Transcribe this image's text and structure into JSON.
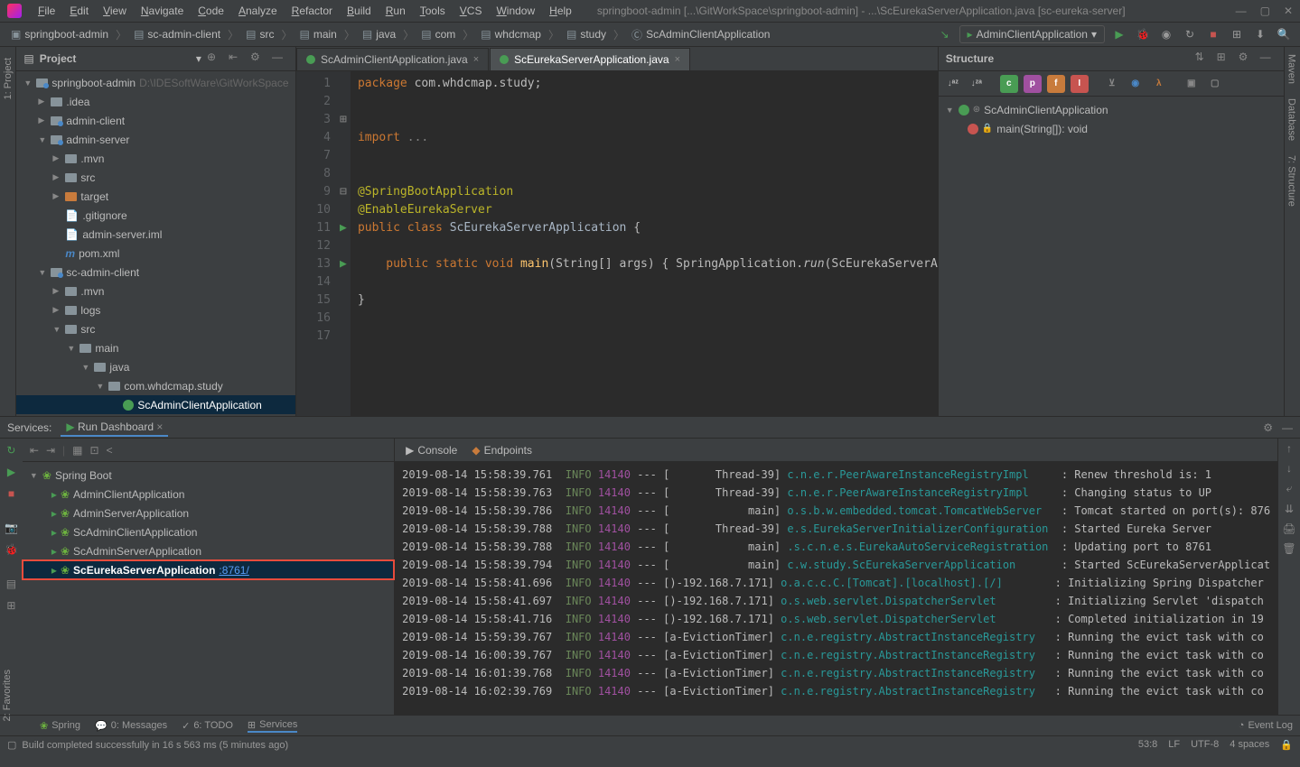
{
  "window": {
    "title": "springboot-admin [...\\GitWorkSpace\\springboot-admin] - ...\\ScEurekaServerApplication.java [sc-eureka-server]"
  },
  "menu": [
    "File",
    "Edit",
    "View",
    "Navigate",
    "Code",
    "Analyze",
    "Refactor",
    "Build",
    "Run",
    "Tools",
    "VCS",
    "Window",
    "Help"
  ],
  "breadcrumb": [
    "springboot-admin",
    "sc-admin-client",
    "src",
    "main",
    "java",
    "com",
    "whdcmap",
    "study",
    "ScAdminClientApplication"
  ],
  "runConfig": "AdminClientApplication",
  "projectPanel": {
    "title": "Project",
    "rootName": "springboot-admin",
    "rootPath": "D:\\IDESoftWare\\GitWorkSpace"
  },
  "tree": [
    {
      "d": 0,
      "exp": "▼",
      "icon": "folder-blue",
      "label": "springboot-admin",
      "hint": "D:\\IDESoftWare\\GitWorkSpace"
    },
    {
      "d": 1,
      "exp": "▶",
      "icon": "folder",
      "label": ".idea"
    },
    {
      "d": 1,
      "exp": "▶",
      "icon": "folder-blue",
      "label": "admin-client"
    },
    {
      "d": 1,
      "exp": "▼",
      "icon": "folder-blue",
      "label": "admin-server"
    },
    {
      "d": 2,
      "exp": "▶",
      "icon": "folder",
      "label": ".mvn"
    },
    {
      "d": 2,
      "exp": "▶",
      "icon": "folder",
      "label": "src"
    },
    {
      "d": 2,
      "exp": "▶",
      "icon": "folder-orange",
      "label": "target"
    },
    {
      "d": 2,
      "exp": "",
      "icon": "file",
      "label": ".gitignore"
    },
    {
      "d": 2,
      "exp": "",
      "icon": "file",
      "label": "admin-server.iml"
    },
    {
      "d": 2,
      "exp": "",
      "icon": "file-m",
      "label": "pom.xml"
    },
    {
      "d": 1,
      "exp": "▼",
      "icon": "folder-blue",
      "label": "sc-admin-client"
    },
    {
      "d": 2,
      "exp": "▶",
      "icon": "folder",
      "label": ".mvn"
    },
    {
      "d": 2,
      "exp": "▶",
      "icon": "folder",
      "label": "logs"
    },
    {
      "d": 2,
      "exp": "▼",
      "icon": "folder",
      "label": "src"
    },
    {
      "d": 3,
      "exp": "▼",
      "icon": "folder",
      "label": "main"
    },
    {
      "d": 4,
      "exp": "▼",
      "icon": "folder",
      "label": "java"
    },
    {
      "d": 5,
      "exp": "▼",
      "icon": "folder",
      "label": "com.whdcmap.study"
    },
    {
      "d": 6,
      "exp": "",
      "icon": "class",
      "label": "ScAdminClientApplication",
      "selected": true
    }
  ],
  "editorTabs": [
    {
      "label": "ScAdminClientApplication.java",
      "active": false
    },
    {
      "label": "ScEurekaServerApplication.java",
      "active": true
    }
  ],
  "code": {
    "lines": [
      "1",
      "2",
      "3",
      "4",
      "",
      "7",
      "8",
      "9",
      "10",
      "11",
      "12",
      "13",
      "14",
      "15",
      "16",
      "17"
    ],
    "l1a": "package ",
    "l1b": "com.whdcmap.study;",
    "l3a": "import ",
    "l3b": "...",
    "l7": "@SpringBootApplication",
    "l8": "@EnableEurekaServer",
    "l9a": "public class ",
    "l9b": "ScEurekaServerApplication ",
    "l9c": "{",
    "l11a": "    public static void ",
    "l11b": "main",
    "l11c": "(String[] args) ",
    "l11d": "{ ",
    "l11e": "SpringApplication.",
    "l11f": "run",
    "l11g": "(ScEurekaServerA",
    "l13": "}"
  },
  "structure": {
    "title": "Structure",
    "root": "ScAdminClientApplication",
    "method": "main(String[]): void"
  },
  "services": {
    "title": "Services:",
    "tab": "Run Dashboard",
    "root": "Spring Boot",
    "apps": [
      {
        "label": "AdminClientApplication"
      },
      {
        "label": "AdminServerApplication"
      },
      {
        "label": "ScAdminClientApplication"
      },
      {
        "label": "ScAdminServerApplication"
      },
      {
        "label": "ScEurekaServerApplication",
        "port": ":8761/",
        "highlighted": true
      }
    ]
  },
  "consoleTabs": [
    "Console",
    "Endpoints"
  ],
  "console": [
    {
      "ts": "2019-08-14 15:58:39.761",
      "lvl": "INFO",
      "pid": "14140",
      "th": "--- [       Thread-39]",
      "cls": "c.n.e.r.PeerAwareInstanceRegistryImpl",
      "msg": ": Renew threshold is: 1"
    },
    {
      "ts": "2019-08-14 15:58:39.763",
      "lvl": "INFO",
      "pid": "14140",
      "th": "--- [       Thread-39]",
      "cls": "c.n.e.r.PeerAwareInstanceRegistryImpl",
      "msg": ": Changing status to UP"
    },
    {
      "ts": "2019-08-14 15:58:39.786",
      "lvl": "INFO",
      "pid": "14140",
      "th": "--- [            main]",
      "cls": "o.s.b.w.embedded.tomcat.TomcatWebServer",
      "msg": ": Tomcat started on port(s): 876"
    },
    {
      "ts": "2019-08-14 15:58:39.788",
      "lvl": "INFO",
      "pid": "14140",
      "th": "--- [       Thread-39]",
      "cls": "e.s.EurekaServerInitializerConfiguration",
      "msg": ": Started Eureka Server"
    },
    {
      "ts": "2019-08-14 15:58:39.788",
      "lvl": "INFO",
      "pid": "14140",
      "th": "--- [            main]",
      "cls": ".s.c.n.e.s.EurekaAutoServiceRegistration",
      "msg": ": Updating port to 8761"
    },
    {
      "ts": "2019-08-14 15:58:39.794",
      "lvl": "INFO",
      "pid": "14140",
      "th": "--- [            main]",
      "cls": "c.w.study.ScEurekaServerApplication",
      "msg": ": Started ScEurekaServerApplicat"
    },
    {
      "ts": "2019-08-14 15:58:41.696",
      "lvl": "INFO",
      "pid": "14140",
      "th": "--- [)-192.168.7.171]",
      "cls": "o.a.c.c.C.[Tomcat].[localhost].[/]",
      "msg": ": Initializing Spring Dispatcher"
    },
    {
      "ts": "2019-08-14 15:58:41.697",
      "lvl": "INFO",
      "pid": "14140",
      "th": "--- [)-192.168.7.171]",
      "cls": "o.s.web.servlet.DispatcherServlet",
      "msg": ": Initializing Servlet 'dispatch"
    },
    {
      "ts": "2019-08-14 15:58:41.716",
      "lvl": "INFO",
      "pid": "14140",
      "th": "--- [)-192.168.7.171]",
      "cls": "o.s.web.servlet.DispatcherServlet",
      "msg": ": Completed initialization in 19"
    },
    {
      "ts": "2019-08-14 15:59:39.767",
      "lvl": "INFO",
      "pid": "14140",
      "th": "--- [a-EvictionTimer]",
      "cls": "c.n.e.registry.AbstractInstanceRegistry",
      "msg": ": Running the evict task with co"
    },
    {
      "ts": "2019-08-14 16:00:39.767",
      "lvl": "INFO",
      "pid": "14140",
      "th": "--- [a-EvictionTimer]",
      "cls": "c.n.e.registry.AbstractInstanceRegistry",
      "msg": ": Running the evict task with co"
    },
    {
      "ts": "2019-08-14 16:01:39.768",
      "lvl": "INFO",
      "pid": "14140",
      "th": "--- [a-EvictionTimer]",
      "cls": "c.n.e.registry.AbstractInstanceRegistry",
      "msg": ": Running the evict task with co"
    },
    {
      "ts": "2019-08-14 16:02:39.769",
      "lvl": "INFO",
      "pid": "14140",
      "th": "--- [a-EvictionTimer]",
      "cls": "c.n.e.registry.AbstractInstanceRegistry",
      "msg": ": Running the evict task with co"
    }
  ],
  "bottomBar": [
    "Spring",
    "0: Messages",
    "6: TODO",
    "Services"
  ],
  "status": {
    "msg": "Build completed successfully in 16 s 563 ms (5 minutes ago)",
    "eventLog": "Event Log",
    "pos": "53:8",
    "lf": "LF",
    "enc": "UTF-8",
    "ind": "4 spaces"
  },
  "leftTabs": [
    "1: Project"
  ],
  "rightTabs": [
    "Maven",
    "Database",
    "7: Structure"
  ],
  "leftBottomTabs": [
    "2: Favorites"
  ]
}
